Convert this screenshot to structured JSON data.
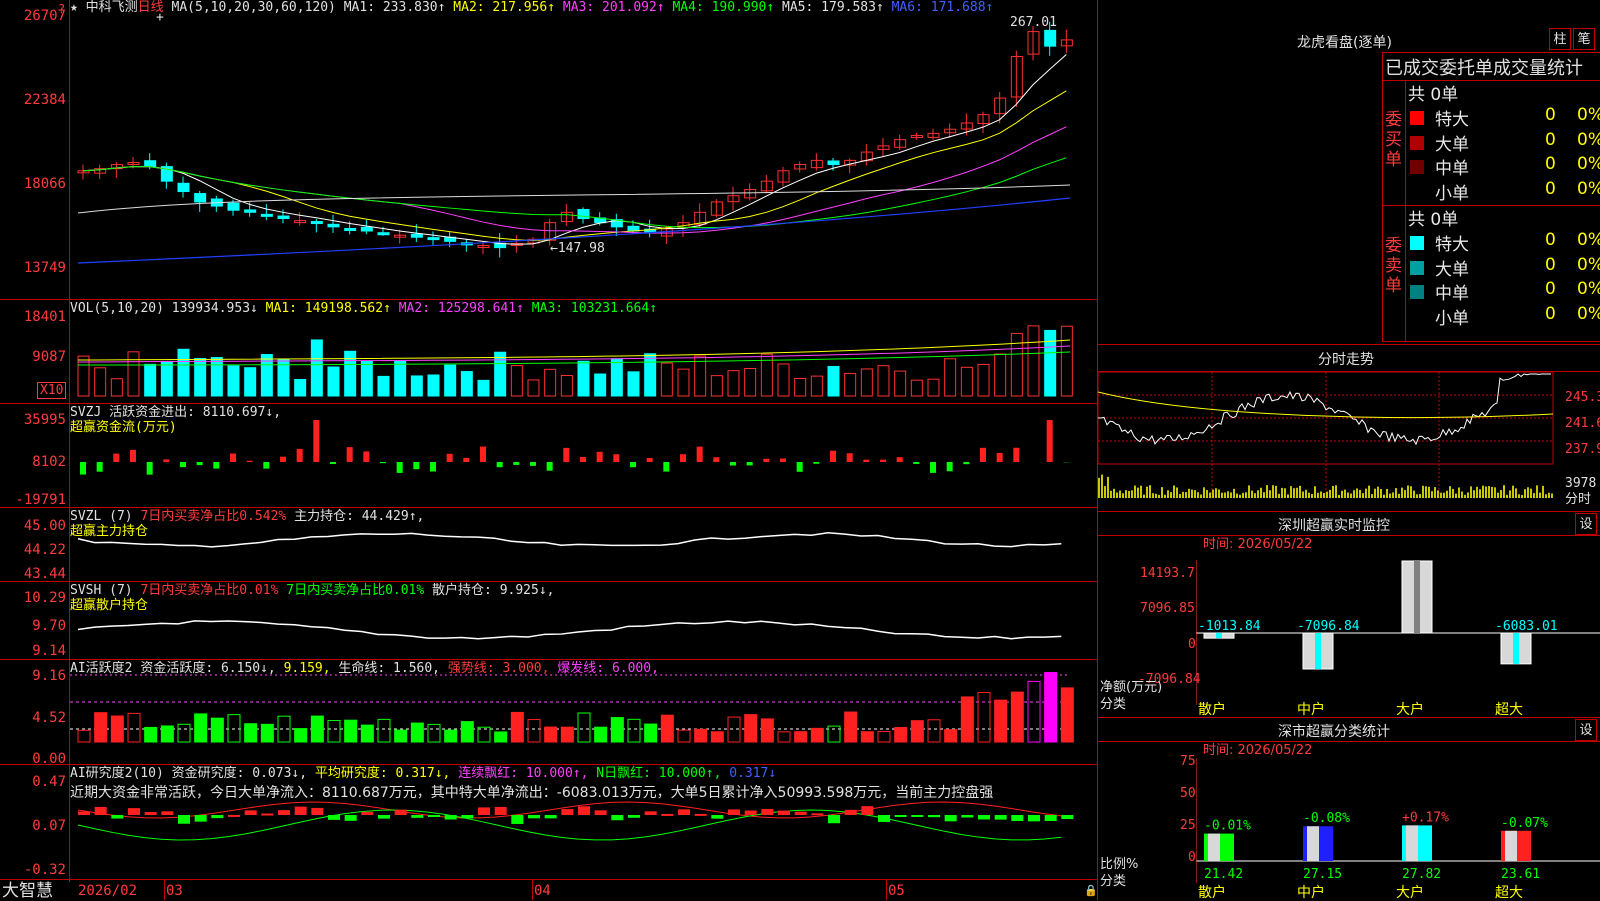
{
  "kline": {
    "title": "中科飞测",
    "period": "日线",
    "ma_text": "MA(5,10,20,30,60,120)",
    "ma1": "MA1: 233.830↑",
    "ma2": "MA2: 217.956↑",
    "ma3": "MA3: 201.092↑",
    "ma4": "MA4: 190.990↑",
    "ma5": "MA5: 179.583↑",
    "ma6": "MA6: 171.688↑",
    "axis": [
      "26707",
      "22384",
      "18066",
      "13749"
    ],
    "high_label": "267.01",
    "low_label": "←147.98"
  },
  "vol": {
    "text": "VOL(5,10,20)",
    "v": "139934.953↓",
    "ma1": "MA1: 149198.562↑",
    "ma2": "MA2: 125298.641↑",
    "ma3": "MA3: 103231.664↑",
    "axis": [
      "18401",
      "9087"
    ],
    "unit": "X10"
  },
  "svzj": {
    "line1": "SVZJ  活跃资金进出: 8110.697↓,",
    "line2": "超赢资金流(万元)",
    "axis": [
      "35995",
      "8102",
      "-19791"
    ]
  },
  "svzl": {
    "a": "SVZL (7)",
    "b": "7日内买卖净占比0.542%",
    "c": "主力持仓: 44.429↑,",
    "line2": "超赢主力持仓",
    "axis": [
      "45.00",
      "44.22",
      "43.44"
    ]
  },
  "svsh": {
    "a": "SVSH (7)",
    "b": "7日内买卖净占比0.01%",
    "c": "7日内买卖净占比0.01%",
    "d": "散户持仓: 9.925↓,",
    "line2": "超赢散户持仓",
    "axis": [
      "10.29",
      "9.70",
      "9.14"
    ]
  },
  "ai1": {
    "a": "AI活跃度2",
    "b": "资金活跃度: 6.150↓,",
    "c": "9.159,",
    "d": "生命线: 1.560,",
    "e": "强势线: 3.000,",
    "f": "爆发线: 6.000,",
    "axis": [
      "9.16",
      "4.52",
      "0.00"
    ]
  },
  "ai2": {
    "a": "AI研究度2(10)",
    "b": "资金研究度: 0.073↓,",
    "c": "平均研究度: 0.317↓,",
    "d": "连续飘红: 10.000↑,",
    "e": "N日飘红: 10.000↑,",
    "f": "0.317↓",
    "summary": "近期大资金非常活跃，今日大单净流入：8110.687万元，其中特大单净流出：-6083.013万元，大单5日累计净入50993.598万元，当前主力控盘强",
    "axis": [
      "0.47",
      "0.07",
      "-0.32"
    ]
  },
  "bottom": {
    "app": "大智慧",
    "d1": "2026/02",
    "d2": "03",
    "d3": "04",
    "d4": "05"
  },
  "dragon": {
    "title": "龙虎看盘(逐单)",
    "btn1": "柱",
    "btn2": "笔",
    "header": "已成交委托单成交量统计",
    "buy_label": "委买单",
    "sell_label": "委卖单",
    "buy_total": "共 0单",
    "sell_total": "共 0单",
    "buy_rows": [
      {
        "name": "特大",
        "n": "0",
        "p": "0%",
        "color": "#ff0000"
      },
      {
        "name": "大单",
        "n": "0",
        "p": "0%",
        "color": "#b00000"
      },
      {
        "name": "中单",
        "n": "0",
        "p": "0%",
        "color": "#700000"
      },
      {
        "name": "小单",
        "n": "0",
        "p": "0%",
        "color": "#000000"
      }
    ],
    "sell_rows": [
      {
        "name": "特大",
        "n": "0",
        "p": "0%",
        "color": "#00ffff"
      },
      {
        "name": "大单",
        "n": "0",
        "p": "0%",
        "color": "#00a0a0"
      },
      {
        "name": "中单",
        "n": "0",
        "p": "0%",
        "color": "#008080"
      },
      {
        "name": "小单",
        "n": "0",
        "p": "0%",
        "color": "#000000"
      }
    ]
  },
  "intraday": {
    "title": "分时走势",
    "axis": [
      "245.3",
      "241.6",
      "237.9"
    ],
    "vol_axis": "3978",
    "vol_unit": "分时"
  },
  "sz_monitor": {
    "title": "深圳超赢实时监控",
    "btn": "设",
    "time": "时间: 2026/05/22",
    "axis": [
      "14193.7",
      "7096.85",
      "0",
      "-7096.84"
    ],
    "ylabel": "净额(万元)",
    "xlabel": "分类",
    "bars": [
      {
        "cat": "散户",
        "val": -1013.84,
        "label": "-1013.84"
      },
      {
        "cat": "中户",
        "val": -7096.84,
        "label": "-7096.84"
      },
      {
        "cat": "大户",
        "val": 14193.7,
        "label": "14193.7"
      },
      {
        "cat": "超大",
        "val": -6083.01,
        "label": "-6083.01"
      }
    ]
  },
  "sz_class": {
    "title": "深市超赢分类统计",
    "btn": "设",
    "time": "时间: 2026/05/22",
    "axis": [
      "75",
      "50",
      "25",
      "0"
    ],
    "ylabel": "比例%",
    "xlabel": "分类",
    "bars": [
      {
        "cat": "散户",
        "val": 21.42,
        "label": "21.42",
        "chg": "-0.01%",
        "color": "#00ff00"
      },
      {
        "cat": "中户",
        "val": 27.15,
        "label": "27.15",
        "chg": "-0.08%",
        "color": "#2020ff"
      },
      {
        "cat": "大户",
        "val": 27.82,
        "label": "27.82",
        "chg": "+0.17%",
        "color": "#00ffff"
      },
      {
        "cat": "超大",
        "val": 23.61,
        "label": "23.61",
        "chg": "-0.07%",
        "color": "#ff2020"
      }
    ]
  }
}
